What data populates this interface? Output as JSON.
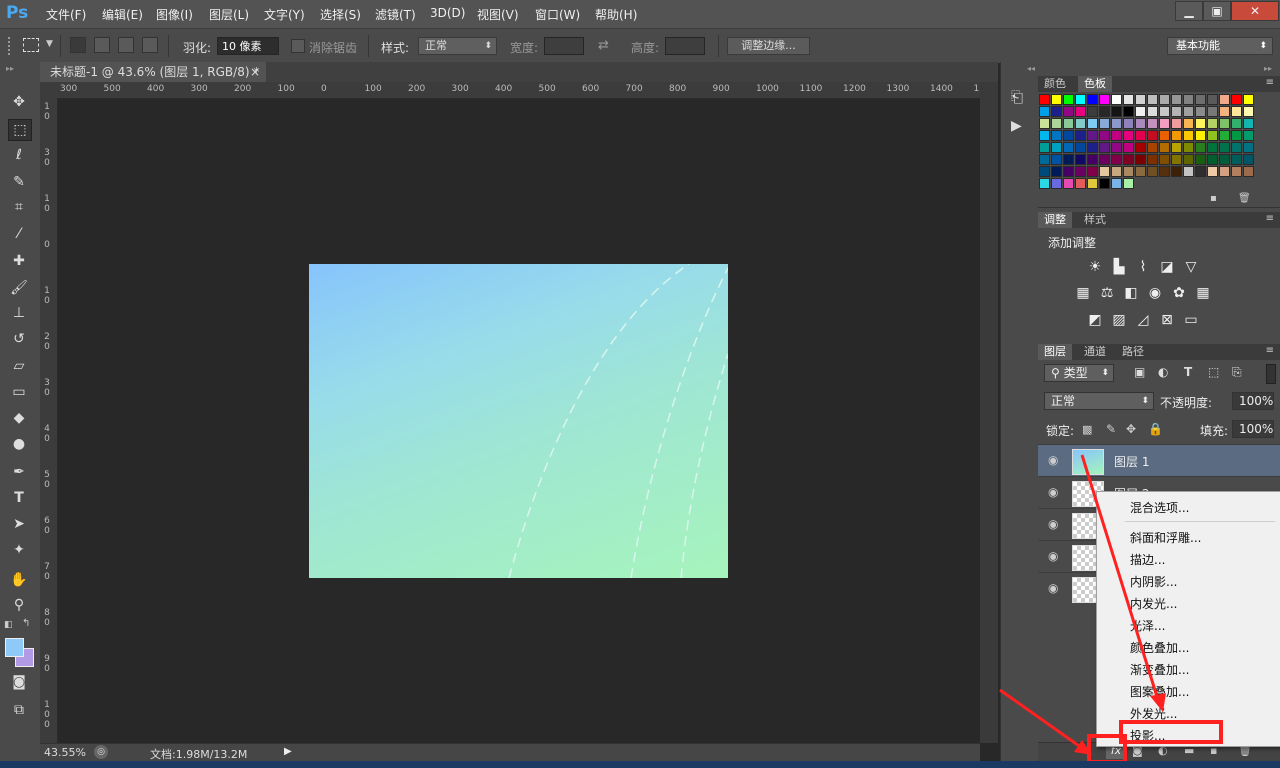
{
  "app": {
    "logo": "Ps"
  },
  "menu": [
    "文件(F)",
    "编辑(E)",
    "图像(I)",
    "图层(L)",
    "文字(Y)",
    "选择(S)",
    "滤镜(T)",
    "3D(D)",
    "视图(V)",
    "窗口(W)",
    "帮助(H)"
  ],
  "window_controls": [
    "▁",
    "▣",
    "✕"
  ],
  "options": {
    "feather_label": "羽化:",
    "feather_value": "10 像素",
    "antialias_label": "消除锯齿",
    "style_label": "样式:",
    "style_value": "正常",
    "width_label": "宽度:",
    "height_label": "高度:",
    "refine_button": "调整边缘...",
    "workspace": "基本功能"
  },
  "document": {
    "tab_title": "未标题-1 @ 43.6% (图层 1, RGB/8) *",
    "tab_close": "×",
    "zoom": "43.55%",
    "doc_info": "文档:1.98M/13.2M",
    "ruler_top": [
      "300",
      "500",
      "400",
      "300",
      "200",
      "100",
      "0",
      "100",
      "200",
      "300",
      "400",
      "500",
      "600",
      "700",
      "800",
      "900",
      "1000",
      "1100",
      "1200",
      "1300",
      "1400",
      "15"
    ],
    "ruler_left": [
      "1 0",
      "3 0",
      "1 0",
      "0",
      "1 0",
      "2 0",
      "3 0",
      "4 0",
      "5 0",
      "6 0",
      "7 0",
      "8 0",
      "9 0",
      "1 0 0"
    ]
  },
  "panels": {
    "color_tabs": [
      "颜色",
      "色板"
    ],
    "adjust_tabs": [
      "调整",
      "样式"
    ],
    "adjust_title": "添加调整",
    "layer_tabs": [
      "图层",
      "通道",
      "路径"
    ],
    "filter_kind": "类型",
    "blend_mode": "正常",
    "opacity_label": "不透明度:",
    "opacity_value": "100%",
    "lock_label": "锁定:",
    "fill_label": "填充:",
    "fill_value": "100%",
    "layers": [
      {
        "name": "图层 1",
        "selected": true
      },
      {
        "name": "图层 2",
        "selected": false
      },
      {
        "name": "",
        "selected": false
      },
      {
        "name": "",
        "selected": false
      },
      {
        "name": "",
        "selected": false
      }
    ]
  },
  "context_menu": {
    "items": [
      "混合选项...",
      "斜面和浮雕...",
      "描边...",
      "内阴影...",
      "内发光...",
      "光泽...",
      "颜色叠加...",
      "渐变叠加...",
      "图案叠加...",
      "外发光...",
      "投影..."
    ]
  },
  "colors": {
    "highlight_red": "#ff2020",
    "accent_blue": "#86c4fc",
    "accent_green": "#a6f4bc",
    "fg_swatch": "#8ec9f7",
    "bg_swatch": "#b39ae6"
  },
  "swatches": [
    "#ff0000",
    "#ffff00",
    "#00ff00",
    "#00ffff",
    "#0000ff",
    "#ff00ff",
    "#ffffff",
    "#e6e6e6",
    "#d2d2d2",
    "#bebebe",
    "#aaaaaa",
    "#969696",
    "#828282",
    "#6e6e6e",
    "#5a5a5a",
    "#f2a98b",
    "#ff0000",
    "#ffff00",
    "#00a0e8",
    "#1d2088",
    "#920783",
    "#e4007f",
    "#3c3c3c",
    "#282828",
    "#141414",
    "#000000",
    "#f0f0f0",
    "#dcdcdc",
    "#c8c8c8",
    "#b4b4b4",
    "#a0a0a0",
    "#8c8c8c",
    "#787878",
    "#f6b37f",
    "#ffe699",
    "#fff9b1",
    "#cce198",
    "#acd598",
    "#89c997",
    "#84ccc9",
    "#7ecef4",
    "#88abda",
    "#8c97cb",
    "#8f82bc",
    "#aa89bd",
    "#c490bf",
    "#f19ec2",
    "#f29c9f",
    "#f8b551",
    "#fff45c",
    "#b3d465",
    "#80c269",
    "#32b16c",
    "#13b5b1",
    "#00b7ee",
    "#0075c2",
    "#00479d",
    "#1d2088",
    "#601986",
    "#920783",
    "#be0081",
    "#e4007f",
    "#e5004f",
    "#c30d23",
    "#eb6100",
    "#f39800",
    "#fcc800",
    "#fff100",
    "#8fc31f",
    "#22ac38",
    "#009944",
    "#009b6b",
    "#009e96",
    "#00a0c1",
    "#0068b7",
    "#00479d",
    "#1d2088",
    "#601986",
    "#920783",
    "#be0081",
    "#a40000",
    "#a84200",
    "#b26c00",
    "#b8a400",
    "#7e8a00",
    "#287e1c",
    "#00743c",
    "#00724c",
    "#00736d",
    "#007283",
    "#006a9b",
    "#0052a2",
    "#001c58",
    "#100964",
    "#440062",
    "#6a005f",
    "#800049",
    "#7e0023",
    "#7b0000",
    "#7c3000",
    "#7f4e00",
    "#837400",
    "#5e6600",
    "#1b5d11",
    "#005e2c",
    "#005d3c",
    "#005e5a",
    "#005569",
    "#00497b",
    "#001c58",
    "#440062",
    "#6a005f",
    "#800049",
    "#e4c6a0",
    "#c7a77f",
    "#aa8860",
    "#8c6a3f",
    "#704f25",
    "#562f0d",
    "#3c2008",
    "#c3c3c3",
    "#2e2e2e",
    "#f0c9a5",
    "#d3a081",
    "#b37f5f",
    "#9b6b4b",
    "#2bd8e3",
    "#6a6ae0",
    "#e34bb0",
    "#e35b5b",
    "#e3c73a",
    "#000000",
    "#7ab3e8",
    "#a8f0a8"
  ]
}
